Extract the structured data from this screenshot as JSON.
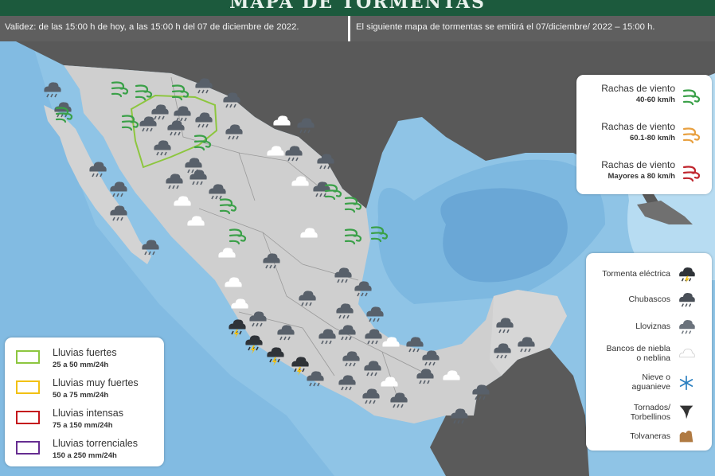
{
  "header": {
    "title": "MAPA DE TORMENTAS",
    "validity": "Validez: de las 15:00 h de hoy, a las 15:00 h del 07 de diciembre de 2022.",
    "next_map": "El siguiente mapa de tormentas se emitirá el 07/diciembre/ 2022 – 15:00 h."
  },
  "wind_legend": [
    {
      "title": "Rachas de viento",
      "range": "40-60 km/h",
      "color": "#3aa048"
    },
    {
      "title": "Rachas de viento",
      "range": "60.1-80 km/h",
      "color": "#e8a040"
    },
    {
      "title": "Rachas de viento",
      "range": "Mayores a 80 km/h",
      "color": "#c0262e"
    }
  ],
  "phenomena_legend": [
    {
      "label": "Tormenta eléctrica",
      "icon": "storm-cloud-lightning-icon"
    },
    {
      "label": "Chubascos",
      "icon": "shower-cloud-icon"
    },
    {
      "label": "Lloviznas",
      "icon": "drizzle-cloud-icon"
    },
    {
      "label": "Bancos de niebla\no neblina",
      "icon": "fog-cloud-icon"
    },
    {
      "label": "Nieve o\naguanieve",
      "icon": "snowflake-icon"
    },
    {
      "label": "Tornados/\nTorbellinos",
      "icon": "tornado-icon"
    },
    {
      "label": "Tolvaneras",
      "icon": "dust-storm-icon"
    }
  ],
  "rain_legend": [
    {
      "name": "Lluvias fuertes",
      "range": "25 a 50 mm/24h",
      "color": "#8dc63f"
    },
    {
      "name": "Lluvias muy fuertes",
      "range": "50 a 75 mm/24h",
      "color": "#f2c114"
    },
    {
      "name": "Lluvias intensas",
      "range": "75 a 150 mm/24h",
      "color": "#c4161c"
    },
    {
      "name": "Lluvias torrenciales",
      "range": "150 a 250 mm/24h",
      "color": "#662d91"
    }
  ],
  "colors": {
    "header_green": "#1c5a3d",
    "validity_bar": "#5f5f5f",
    "ocean": "#8fc4e6",
    "usa_land": "#595959",
    "mexico_land": "#cfcfcf",
    "guatemala_land": "#5a5a5a"
  }
}
